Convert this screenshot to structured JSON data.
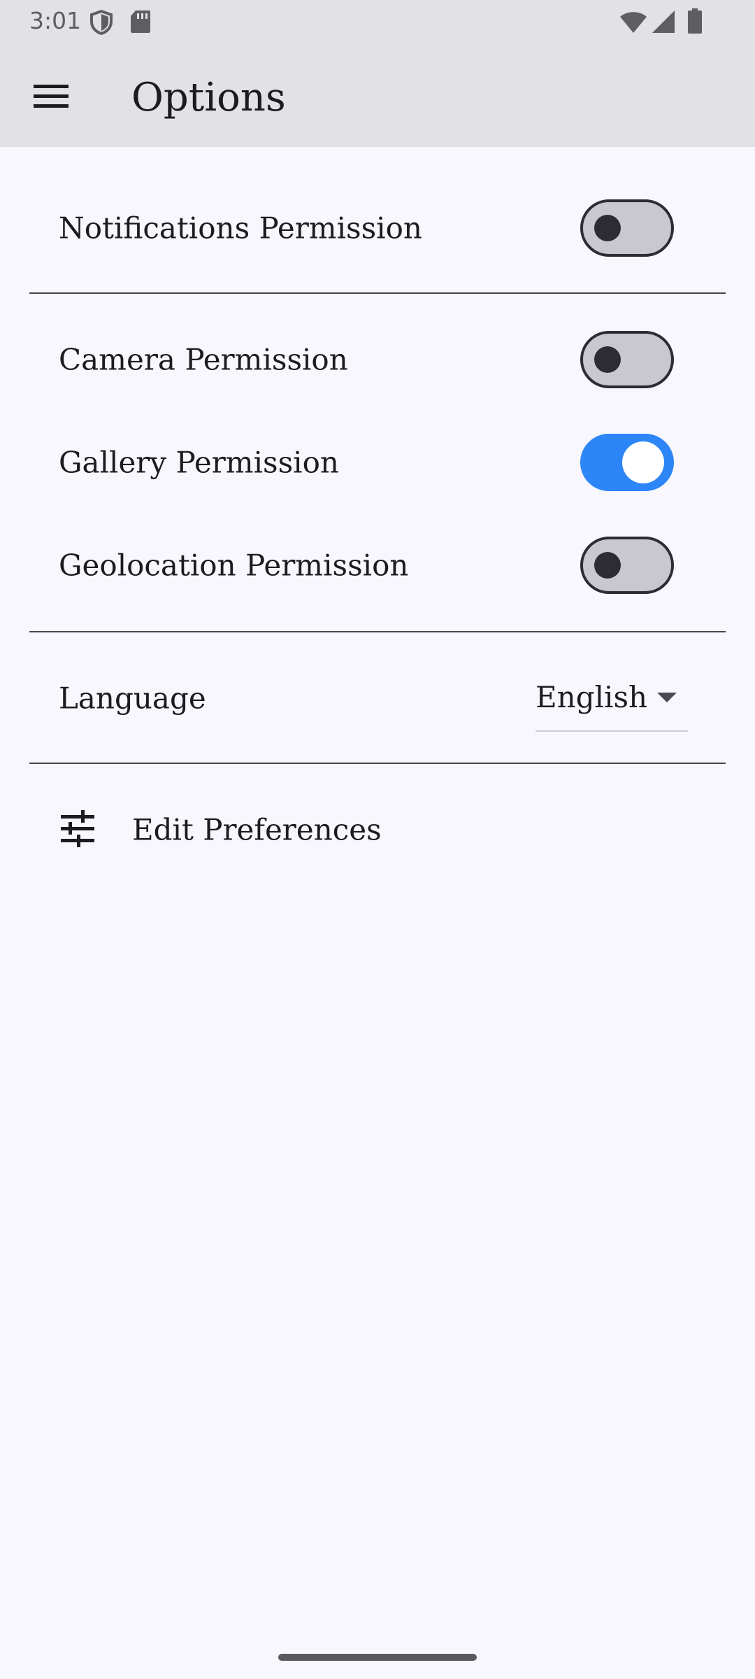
{
  "status_bar": {
    "time": "3:01",
    "icons": [
      "shield-icon",
      "sd-card-icon",
      "wifi-icon",
      "signal-icon",
      "battery-icon"
    ]
  },
  "app_bar": {
    "menu_icon": "menu-icon",
    "title": "Options"
  },
  "permissions": {
    "notifications": {
      "label": "Notifications Permission",
      "enabled": false
    },
    "camera": {
      "label": "Camera Permission",
      "enabled": false
    },
    "gallery": {
      "label": "Gallery Permission",
      "enabled": true
    },
    "geolocation": {
      "label": "Geolocation Permission",
      "enabled": false
    }
  },
  "language": {
    "label": "Language",
    "selected": "English"
  },
  "preferences": {
    "icon": "tune-icon",
    "label": "Edit Preferences"
  },
  "colors": {
    "background": "#f8f7fd",
    "app_bar": "#e2e1e4",
    "switch_on": "#2d86f7",
    "switch_off_track": "#c9c8cf",
    "switch_off_outline": "#2d2c35"
  }
}
